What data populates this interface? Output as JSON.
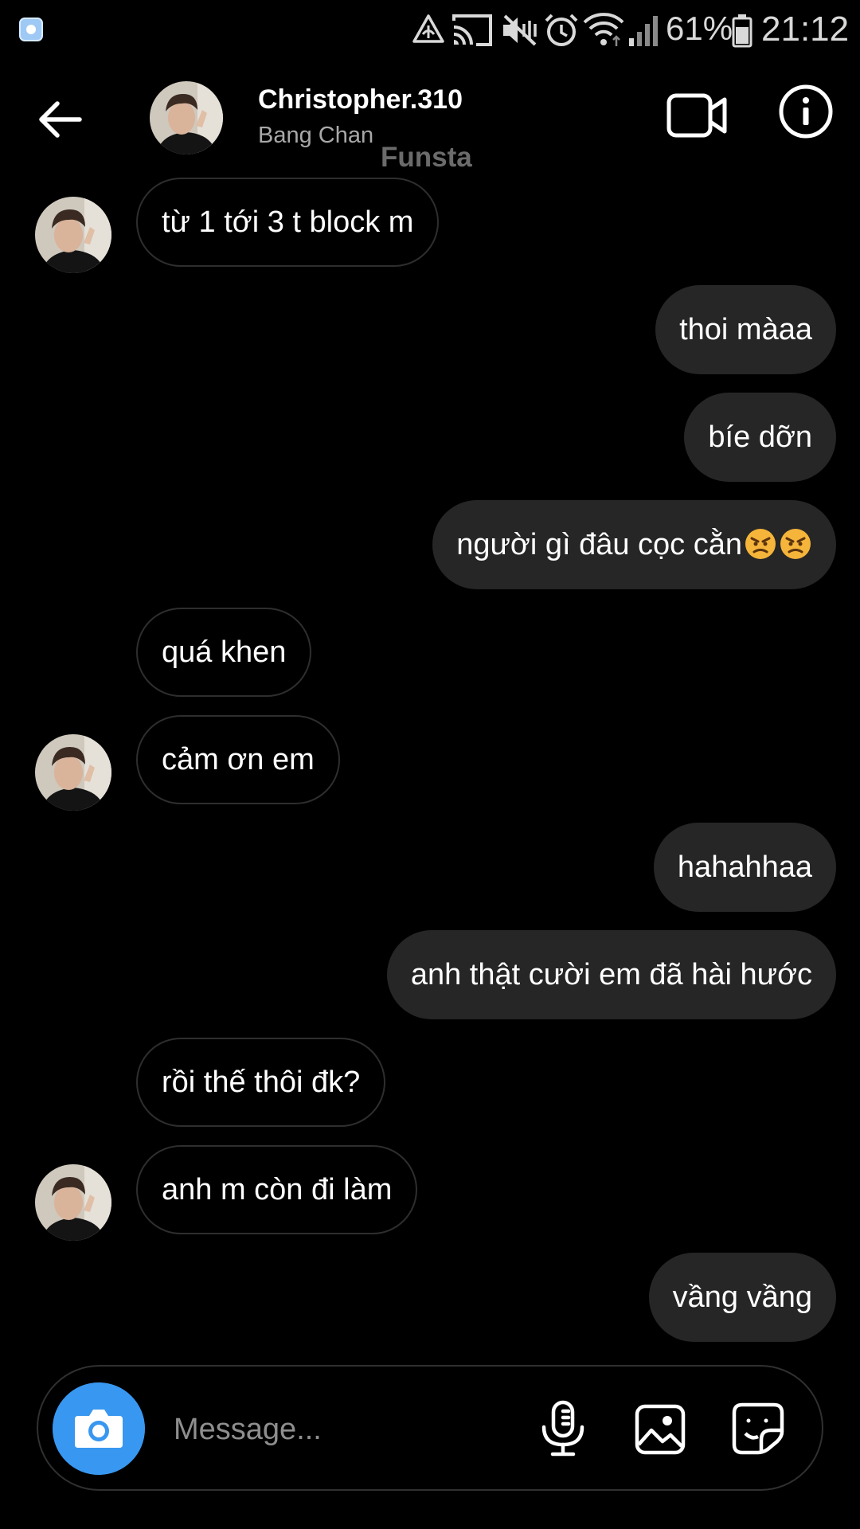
{
  "status_bar": {
    "battery_percent": "61%",
    "time": "21:12",
    "icons": [
      "app-notification-icon",
      "data-saver-icon",
      "cast-icon",
      "vibrate-mute-icon",
      "alarm-icon",
      "wifi-icon",
      "cellular-signal-icon",
      "battery-icon"
    ]
  },
  "header": {
    "username": "Christopher.310",
    "full_name": "Bang Chan",
    "watermark": "Funsta",
    "icons": [
      "back-arrow-icon",
      "video-camera-icon",
      "info-icon"
    ]
  },
  "messages": [
    {
      "direction": "incoming",
      "text": "từ 1 tới 3 t block m",
      "show_avatar": true
    },
    {
      "direction": "outgoing",
      "text": "thoi màaa"
    },
    {
      "direction": "outgoing",
      "text": "bíe dỡn"
    },
    {
      "direction": "outgoing",
      "text": "người gì đâu cọc cằn",
      "emoji": [
        "angry-face",
        "angry-face"
      ]
    },
    {
      "direction": "incoming",
      "text": "quá khen",
      "show_avatar": false
    },
    {
      "direction": "incoming",
      "text": "cảm ơn em",
      "show_avatar": true
    },
    {
      "direction": "outgoing",
      "text": "hahahhaa"
    },
    {
      "direction": "outgoing",
      "text": "anh thật cười em đã hài hước"
    },
    {
      "direction": "incoming",
      "text": "rồi thế thôi đk?",
      "show_avatar": false
    },
    {
      "direction": "incoming",
      "text": "anh m còn đi làm",
      "show_avatar": true
    },
    {
      "direction": "outgoing",
      "text": "vầng vầng"
    }
  ],
  "composer": {
    "placeholder": "Message...",
    "icons": [
      "camera-icon",
      "microphone-icon",
      "gallery-icon",
      "sticker-icon"
    ]
  },
  "colors": {
    "background": "#000000",
    "outgoing_bubble": "#262626",
    "incoming_border": "#2e2e2e",
    "camera_button": "#3897f0",
    "secondary_text": "#a8a8a8"
  }
}
